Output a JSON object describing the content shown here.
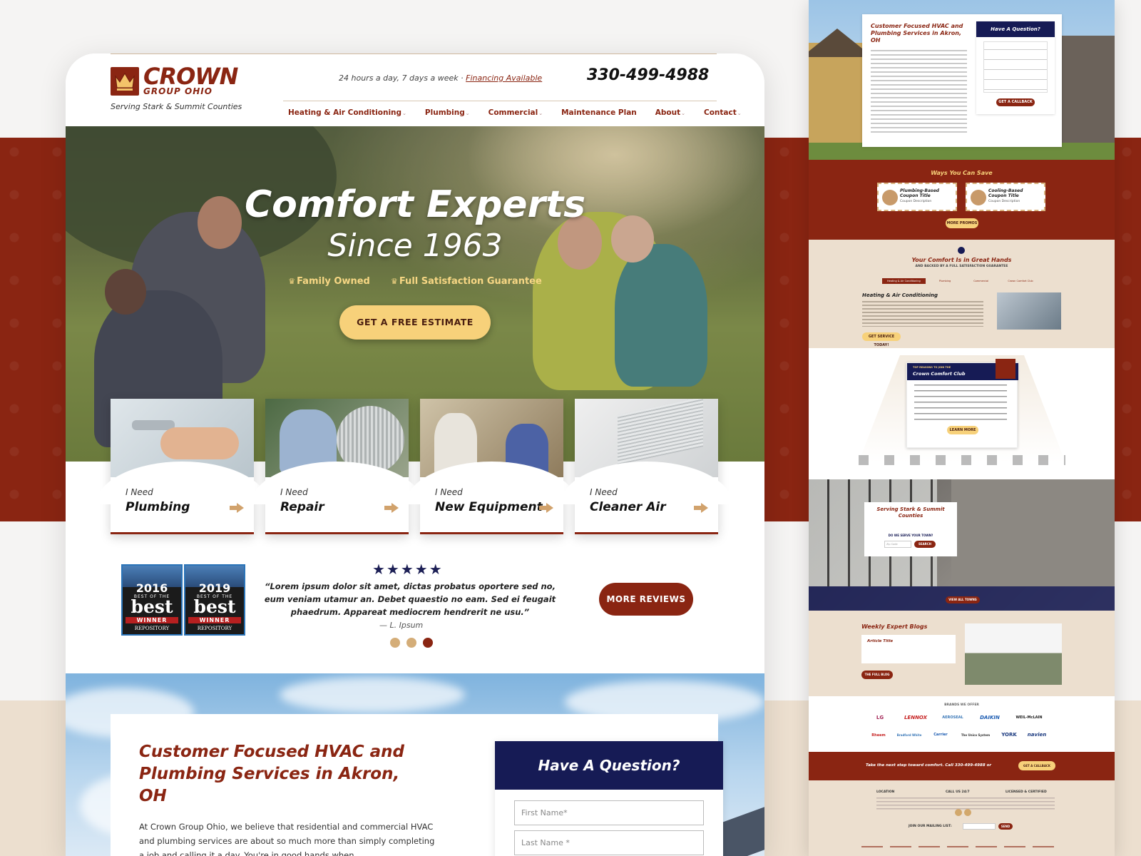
{
  "brand": {
    "name": "CROWN",
    "sub": "GROUP OHIO",
    "tagline": "Serving Stark & Summit Counties",
    "hours": "24 hours a day, 7 days a week · ",
    "financing": "Financing Available",
    "phone": "330-499-4988",
    "color_primary": "#8a2512",
    "color_navy": "#161b55",
    "color_gold": "#f7d17a"
  },
  "nav": [
    {
      "label": "Heating & Air Conditioning",
      "dropdown": true
    },
    {
      "label": "Plumbing",
      "dropdown": true
    },
    {
      "label": "Commercial",
      "dropdown": true
    },
    {
      "label": "Maintenance Plan",
      "dropdown": false
    },
    {
      "label": "About",
      "dropdown": true
    },
    {
      "label": "Contact",
      "dropdown": true
    }
  ],
  "hero": {
    "title": "Comfort Experts",
    "subtitle": "Since 1963",
    "badges": [
      "Family Owned",
      "Full Satisfaction Guarantee"
    ],
    "cta": "GET A FREE ESTIMATE"
  },
  "services": [
    {
      "need": "I Need",
      "title": "Plumbing",
      "icon": "arrow-right-icon"
    },
    {
      "need": "I Need",
      "title": "Repair",
      "icon": "arrow-right-icon"
    },
    {
      "need": "I Need",
      "title": "New Equipment",
      "icon": "arrow-right-icon"
    },
    {
      "need": "I Need",
      "title": "Cleaner Air",
      "icon": "arrow-right-icon"
    }
  ],
  "awards": [
    {
      "year": "2016",
      "top": "BEST OF THE",
      "best": "best",
      "win": "WINNER",
      "pub": "REPOSITORY"
    },
    {
      "year": "2019",
      "top": "BEST OF THE",
      "best": "best",
      "win": "WINNER",
      "pub": "REPOSITORY"
    }
  ],
  "review": {
    "stars": "★★★★★",
    "rating": 5,
    "quote": "“Lorem ipsum dolor sit amet, dictas probatus oportere sed no, eum veniam utamur an. Debet quaestio no eam. Sed ei feugait phaedrum. Appareat mediocrem hendrerit ne usu.”",
    "author": "— L. Ipsum",
    "button": "MORE REVIEWS"
  },
  "about": {
    "title": "Customer Focused HVAC and Plumbing Services in Akron, OH",
    "body": "At Crown Group Ohio, we believe that residential and commercial HVAC and plumbing services are about so much more than simply completing a job and calling it a day. You're in good hands when"
  },
  "question_form": {
    "title": "Have A Question?",
    "first_name": "First Name*",
    "last_name": "Last Name *"
  },
  "thumb": {
    "about_title": "Customer Focused HVAC and Plumbing Services in Akron, OH",
    "question": "Have A Question?",
    "callback": "GET A CALLBACK",
    "ways_save": "Ways You Can Save",
    "coupon1": "Plumbing-Based Coupon Title",
    "coupon2": "Cooling-Based Coupon Title",
    "coupon_desc": "Coupon Description",
    "more_promos": "MORE PROMOS",
    "comfort_title": "Your Comfort Is in Great Hands",
    "comfort_sub": "AND BACKED BY A FULL SATISFACTION GUARANTEE",
    "tabs": [
      "Heating & Air Conditioning",
      "Plumbing",
      "Commercial",
      "Crown Comfort Club"
    ],
    "hac_title": "Heating & Air Conditioning",
    "service_today": "GET SERVICE TODAY!",
    "club_kicker": "TOP REASONS TO JOIN THE",
    "club_title": "Crown Comfort Club",
    "learn_more": "LEARN MORE",
    "serving_title": "Serving Stark & Summit Counties",
    "serve_q": "DO WE SERVE YOUR TOWN?",
    "zip": "Zip Code",
    "search": "SEARCH",
    "view_towns": "VIEW ALL TOWNS",
    "blogs_title": "Weekly Expert Blogs",
    "article": "Article Title",
    "full_blog": "THE FULL BLOG",
    "brands_title": "BRANDS WE OFFER",
    "brands": [
      "LG",
      "LENNOX",
      "AEROSEAL",
      "DAIKIN",
      "WEIL-McLAIN",
      "Rheem",
      "Bradford White",
      "Carrier",
      "The Unico System",
      "YORK",
      "navien"
    ],
    "next_step": "Take the next step toward comfort.  Call 330-499-4988 or",
    "callback2": "GET A CALLBACK",
    "footer_cols": [
      "LOCATION",
      "CALL US 24/7",
      "LICENSED & CERTIFIED"
    ],
    "mailing": "JOIN OUR MAILING LIST:",
    "send": "SEND"
  }
}
